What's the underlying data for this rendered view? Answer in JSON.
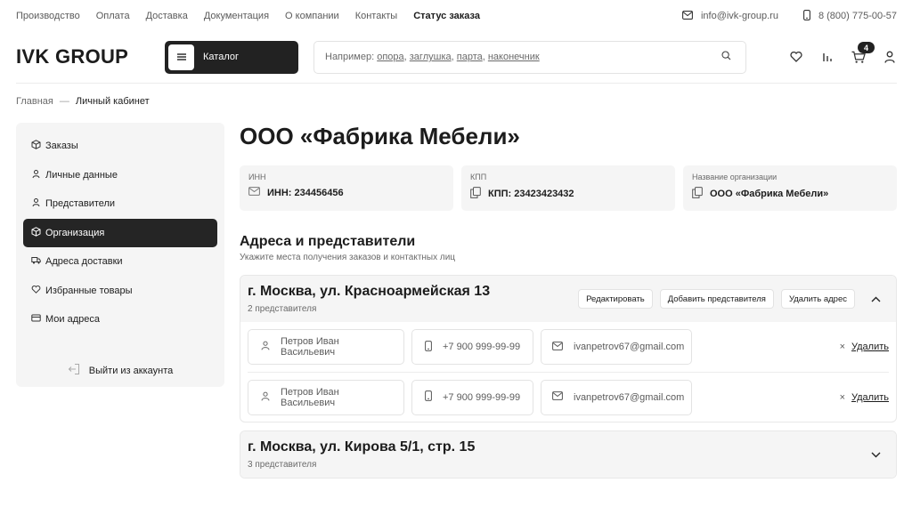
{
  "topnav": {
    "items": [
      "Производство",
      "Оплата",
      "Доставка",
      "Документация",
      "О компании",
      "Контакты",
      "Статус заказа"
    ],
    "active_index": 6
  },
  "contacts": {
    "email": "info@ivk-group.ru",
    "phone": "8 (800) 775-00-57"
  },
  "header": {
    "logo": "IVK GROUP",
    "catalog_label": "Каталог",
    "search": {
      "prefix": "Например: ",
      "examples": [
        "опора",
        "заглушка",
        "парта",
        "наконечник"
      ]
    },
    "cart_count": "4"
  },
  "breadcrumb": {
    "home": "Главная",
    "separator": "—",
    "current": "Личный кабинет"
  },
  "sidebar": {
    "items": [
      {
        "label": "Заказы",
        "icon": "box-icon"
      },
      {
        "label": "Личные данные",
        "icon": "user-icon"
      },
      {
        "label": "Представители",
        "icon": "user-icon"
      },
      {
        "label": "Организация",
        "icon": "box-icon"
      },
      {
        "label": "Адреса доставки",
        "icon": "truck-icon"
      },
      {
        "label": "Избранные товары",
        "icon": "heart-icon"
      },
      {
        "label": "Мои адреса",
        "icon": "card-icon"
      }
    ],
    "active_index": 3,
    "logout_label": "Выйти из аккаунта"
  },
  "main": {
    "org_title": "ООО «Фабрика Мебели»",
    "info": [
      {
        "label": "ИНН",
        "value": "ИНН: 234456456",
        "icon": "mail-icon"
      },
      {
        "label": "КПП",
        "value": "КПП: 23423423432",
        "icon": "copy-icon"
      },
      {
        "label": "Название организации",
        "value": "ООО «Фабрика Мебели»",
        "icon": "copy-icon"
      }
    ],
    "section_title": "Адреса и представители",
    "section_sub": "Укажите места получения заказов и контактных лиц",
    "addresses": [
      {
        "name": "г. Москва, ул. Красноармейская 13",
        "count": "2 представителя",
        "actions": {
          "edit": "Редактировать",
          "add": "Добавить представителя",
          "delete": "Удалить адрес"
        },
        "expanded": true,
        "reps": [
          {
            "name": "Петров Иван Васильевич",
            "phone": "+7 900 999-99-99",
            "email": "ivanpetrov67@gmail.com",
            "delete": "Удалить",
            "x": "×"
          },
          {
            "name": "Петров Иван Васильевич",
            "phone": "+7 900 999-99-99",
            "email": "ivanpetrov67@gmail.com",
            "delete": "Удалить",
            "x": "×"
          }
        ]
      },
      {
        "name": "г. Москва, ул. Кирова 5/1, стр. 15",
        "count": "3 представителя",
        "expanded": false
      }
    ]
  }
}
